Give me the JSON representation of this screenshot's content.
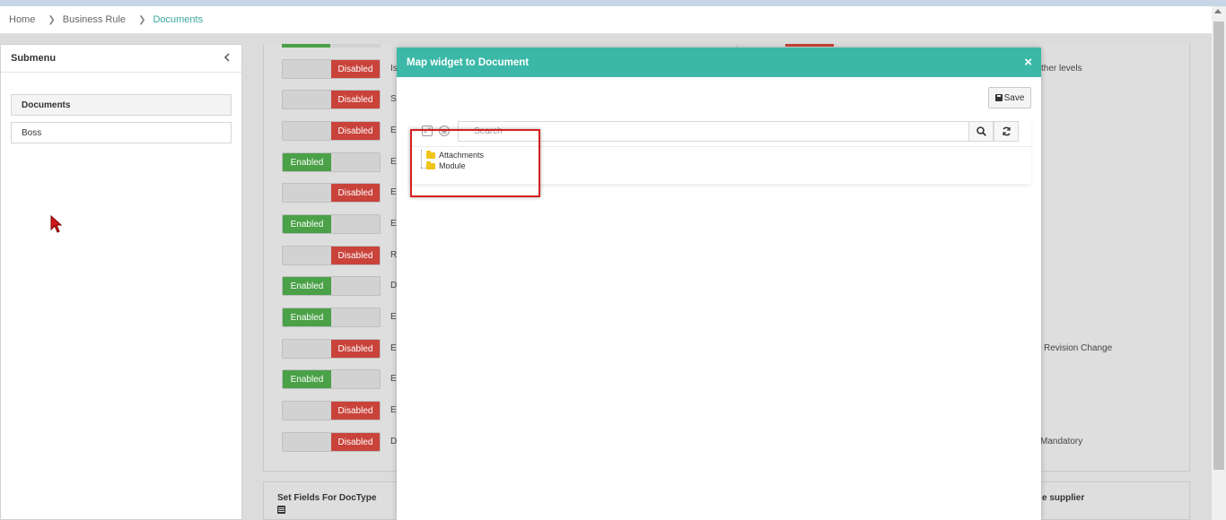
{
  "breadcrumb": {
    "items": [
      "Home",
      "Business Rule",
      "Documents"
    ]
  },
  "submenu": {
    "title": "Submenu",
    "items": [
      "Documents",
      "Boss"
    ]
  },
  "toggles": {
    "rows": [
      {
        "state": "Disabled",
        "letter": "Is"
      },
      {
        "state": "Disabled",
        "letter": "S"
      },
      {
        "state": "Disabled",
        "letter": "E"
      },
      {
        "state": "Enabled",
        "letter": "E"
      },
      {
        "state": "Disabled",
        "letter": "E"
      },
      {
        "state": "Enabled",
        "letter": "E"
      },
      {
        "state": "Disabled",
        "letter": "R"
      },
      {
        "state": "Enabled",
        "letter": "D"
      },
      {
        "state": "Enabled",
        "letter": "E"
      },
      {
        "state": "Disabled",
        "letter": "E"
      },
      {
        "state": "Enabled",
        "letter": "E"
      },
      {
        "state": "Disabled",
        "letter": "E"
      },
      {
        "state": "Disabled",
        "letter": "D"
      }
    ]
  },
  "right_column": {
    "texts": [
      "ther levels",
      "Revision Change",
      "Mandatory"
    ]
  },
  "bottom_section": {
    "left_title": "Set Fields For DocType",
    "right_title": "e supplier"
  },
  "modal": {
    "title": "Map widget to Document",
    "close": "×",
    "save_label": "Save",
    "search_placeholder": "Search",
    "tree_nodes": [
      "Attachments",
      "Module"
    ]
  },
  "colors": {
    "accent": "#3bb8a7",
    "enabled": "#4aa147",
    "disabled": "#c9433b",
    "highlight": "#d42020"
  }
}
